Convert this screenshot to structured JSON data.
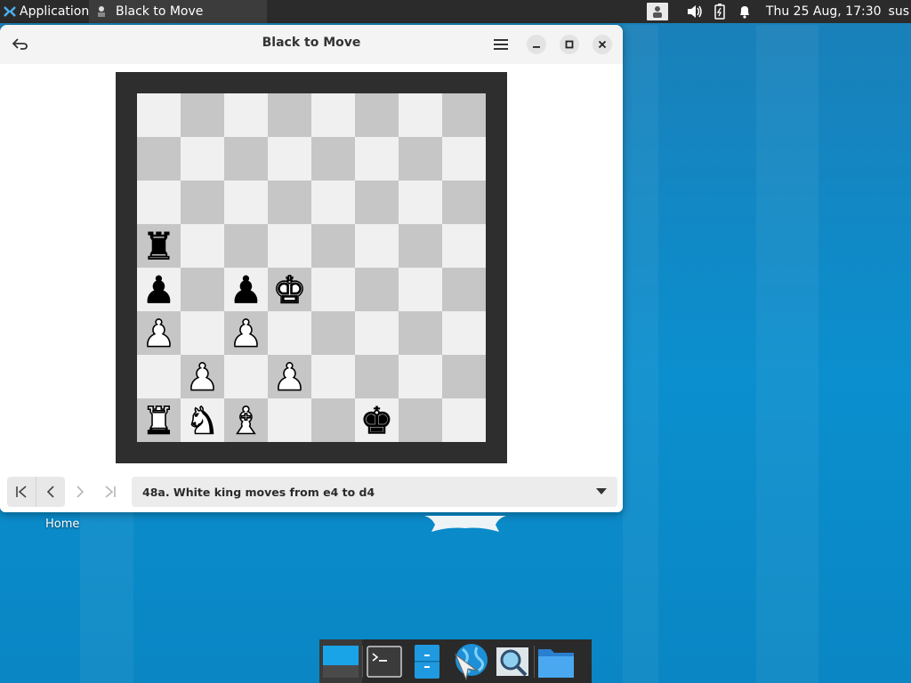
{
  "panel": {
    "applications_label": "Applications",
    "task_title": "Black to Move",
    "clock": "Thu 25 Aug, 17:30",
    "user": "sus"
  },
  "window": {
    "title": "Black to Move"
  },
  "board": {
    "light_color": "#f0f0f0",
    "dark_color": "#c6c6c6",
    "frame_color": "#2e2e2e",
    "ranks_top_to_bottom": [
      "........",
      "........",
      "........",
      "r.......",
      "p.pK....",
      "P.P.....",
      ".P.P....",
      "RNB..k.."
    ]
  },
  "navigation": {
    "first_icon": "skip-to-start-icon",
    "prev_icon": "chevron-left-icon",
    "next_icon": "chevron-right-icon",
    "last_icon": "skip-to-end-icon",
    "move_selected": "48a. White king moves from e4 to d4"
  },
  "desktop": {
    "home_label": "Home"
  },
  "dock": {
    "items": [
      "show-desktop-icon",
      "terminal-icon",
      "file-manager-icon",
      "web-browser-icon",
      "search-icon",
      "folder-icon"
    ]
  },
  "colors": {
    "accent": "#0b8fce",
    "panel": "#2b2b2b"
  }
}
